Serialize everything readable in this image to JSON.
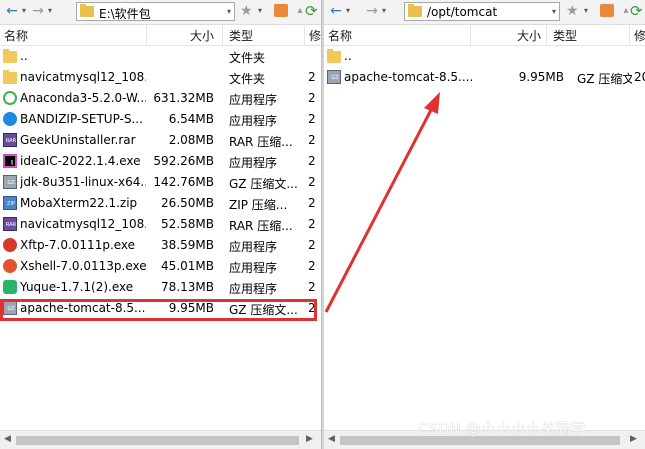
{
  "left": {
    "path": "E:\\软件包",
    "columns": {
      "name": "名称",
      "size": "大小",
      "type": "类型",
      "date": "修"
    },
    "files": [
      {
        "name": "..",
        "size": "",
        "type": "文件夹",
        "date": "",
        "icon": "folder-icon"
      },
      {
        "name": "navicatmysql12_108...",
        "size": "",
        "type": "文件夹",
        "date": "2",
        "icon": "folder-icon"
      },
      {
        "name": "Anaconda3-5.2.0-W...",
        "size": "631.32MB",
        "type": "应用程序",
        "date": "2",
        "icon": "anaconda-icon"
      },
      {
        "name": "BANDIZIP-SETUP-S...",
        "size": "6.54MB",
        "type": "应用程序",
        "date": "2",
        "icon": "bandizip-icon"
      },
      {
        "name": "GeekUninstaller.rar",
        "size": "2.08MB",
        "type": "RAR 压缩...",
        "date": "2",
        "icon": "rar-archive-icon"
      },
      {
        "name": "ideaIC-2022.1.4.exe",
        "size": "592.26MB",
        "type": "应用程序",
        "date": "2",
        "icon": "intellij-idea-icon"
      },
      {
        "name": "jdk-8u351-linux-x64...",
        "size": "142.76MB",
        "type": "GZ 压缩文...",
        "date": "2",
        "icon": "gz-archive-icon"
      },
      {
        "name": "MobaXterm22.1.zip",
        "size": "26.50MB",
        "type": "ZIP 压缩...",
        "date": "2",
        "icon": "zip-archive-icon"
      },
      {
        "name": "navicatmysql12_108...",
        "size": "52.58MB",
        "type": "RAR 压缩...",
        "date": "2",
        "icon": "rar-archive-icon"
      },
      {
        "name": "Xftp-7.0.0111p.exe",
        "size": "38.59MB",
        "type": "应用程序",
        "date": "2",
        "icon": "xftp-icon"
      },
      {
        "name": "Xshell-7.0.0113p.exe",
        "size": "45.01MB",
        "type": "应用程序",
        "date": "2",
        "icon": "xshell-icon"
      },
      {
        "name": "Yuque-1.7.1(2).exe",
        "size": "78.13MB",
        "type": "应用程序",
        "date": "2",
        "icon": "yuque-icon"
      },
      {
        "name": "apache-tomcat-8.5....",
        "size": "9.95MB",
        "type": "GZ 压缩文...",
        "date": "2",
        "icon": "gz-archive-icon"
      }
    ]
  },
  "right": {
    "path": "/opt/tomcat",
    "columns": {
      "name": "名称",
      "size": "大小",
      "type": "类型",
      "date": "修"
    },
    "files": [
      {
        "name": "..",
        "size": "",
        "type": "",
        "date": "",
        "icon": "folder-icon"
      },
      {
        "name": "apache-tomcat-8.5....",
        "size": "9.95MB",
        "type": "GZ 压缩文...",
        "date": "20",
        "icon": "gz-archive-icon"
      }
    ]
  },
  "toolbar": {
    "back_icon": "←",
    "forward_icon": "→",
    "dropdown_icon": "▾",
    "star_icon": "★",
    "refresh_icon": "⟳"
  },
  "annotation": {
    "highlight_color": "#e03030",
    "arrow_color": "#e03030"
  },
  "watermark": "CSDN @小小小小关同学"
}
